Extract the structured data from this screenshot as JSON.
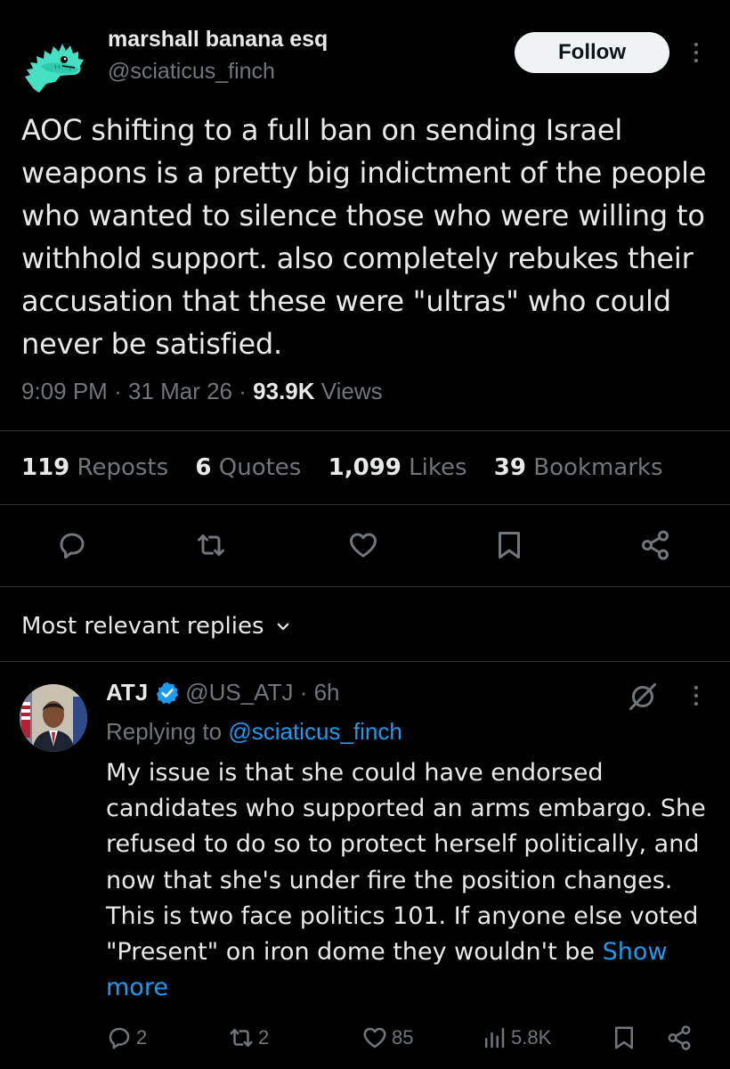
{
  "post": {
    "author_name": "marshall banana esq",
    "author_handle": "@sciaticus_finch",
    "follow_label": "Follow",
    "text": "AOC shifting to a full ban on sending Israel weapons is a pretty big indictment of the people who wanted to silence those who were willing to withhold support. also completely rebukes their accusation that these were \"ultras\" who could never be satisfied.",
    "time": "9:09 PM",
    "date": "31 Mar 26",
    "views_count": "93.9K",
    "views_label": "Views",
    "stats": [
      {
        "count": "119",
        "label": "Reposts"
      },
      {
        "count": "6",
        "label": "Quotes"
      },
      {
        "count": "1,099",
        "label": "Likes"
      },
      {
        "count": "39",
        "label": "Bookmarks"
      }
    ],
    "actions": [
      "reply-icon",
      "repost-icon",
      "like-icon",
      "bookmark-icon",
      "share-icon"
    ]
  },
  "replies_header": "Most relevant replies",
  "reply": {
    "name": "ATJ",
    "handle": "@US_ATJ",
    "time": "6h",
    "replying_prefix": "Replying to",
    "replying_to": "@sciaticus_finch",
    "text": "My issue is that she could have endorsed candidates who supported an arms embargo. She refused to do so to protect herself politically, and now that she's under fire the position changes. This is two face politics 101. If anyone else voted \"Present\" on iron dome they wouldn't be",
    "show_more": "Show more",
    "actions": {
      "replies": "2",
      "reposts": "2",
      "likes": "85",
      "views": "5.8K"
    }
  },
  "colors": {
    "background": "#000000",
    "text": "#e7e9ea",
    "muted": "#71767b",
    "link": "#1d9bf0",
    "divider": "#2f3336",
    "follow_bg": "#eff3f4"
  }
}
